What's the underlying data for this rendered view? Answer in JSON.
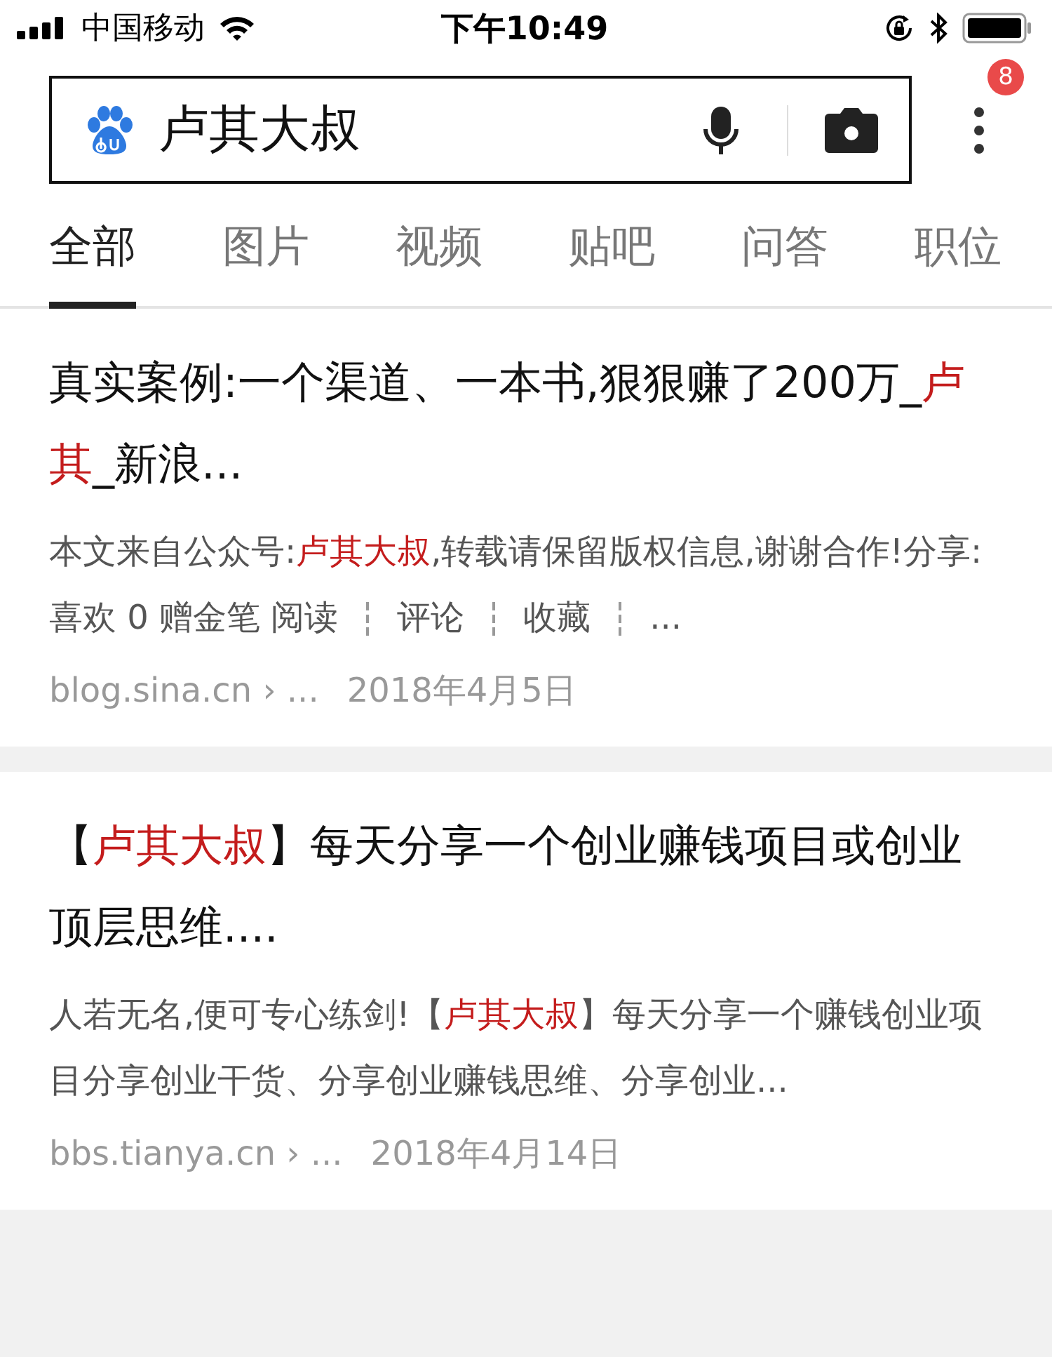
{
  "status_bar": {
    "carrier": "中国移动",
    "time": "下午10:49"
  },
  "search": {
    "value": "卢其大叔",
    "menu_badge": "8"
  },
  "tabs": [
    {
      "label": "全部",
      "selected": true
    },
    {
      "label": "图片",
      "selected": false
    },
    {
      "label": "视频",
      "selected": false
    },
    {
      "label": "贴吧",
      "selected": false
    },
    {
      "label": "问答",
      "selected": false
    },
    {
      "label": "职位",
      "selected": false
    }
  ],
  "results": [
    {
      "title": [
        {
          "kind": "plain",
          "text": "真实案例:一个渠道、一本书,狠狠赚了200万_"
        },
        {
          "kind": "highlight",
          "text": "卢其"
        },
        {
          "kind": "plain",
          "text": "_新浪..."
        }
      ],
      "snippet": [
        {
          "kind": "plain",
          "text": "本文来自公众号:"
        },
        {
          "kind": "highlight",
          "text": "卢其大叔"
        },
        {
          "kind": "plain",
          "text": ",转载请保留版权信息,谢谢合作!分享: 喜欢 0 赠金笔 阅读"
        },
        {
          "kind": "divider"
        },
        {
          "kind": "plain",
          "text": "评论"
        },
        {
          "kind": "divider"
        },
        {
          "kind": "plain",
          "text": "收藏"
        },
        {
          "kind": "divider"
        },
        {
          "kind": "plain",
          "text": "..."
        }
      ],
      "source": "blog.sina.cn › ...",
      "date": "2018年4月5日"
    },
    {
      "title": [
        {
          "kind": "plain",
          "text": "【"
        },
        {
          "kind": "highlight",
          "text": "卢其大叔"
        },
        {
          "kind": "plain",
          "text": "】每天分享一个创业赚钱项目或创业顶层思维...."
        }
      ],
      "snippet": [
        {
          "kind": "plain",
          "text": "人若无名,便可专心练剑!【"
        },
        {
          "kind": "highlight",
          "text": "卢其大叔"
        },
        {
          "kind": "plain",
          "text": "】每天分享一个赚钱创业项目分享创业干货、分享创业赚钱思维、分享创业..."
        }
      ],
      "source": "bbs.tianya.cn › ...",
      "date": "2018年4月14日"
    }
  ]
}
